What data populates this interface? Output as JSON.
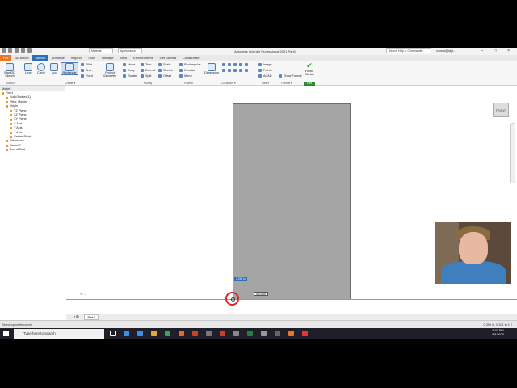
{
  "window": {
    "title": "Autodesk Inventor Professional 2021   Part1",
    "material": "Material",
    "appearance": "Appearance",
    "search_placeholder": "Search Help & Commands...",
    "user": "rcfusca@digit...",
    "controls": "– □ ×"
  },
  "ribbon_tabs": [
    "File",
    "3D Model",
    "Sketch",
    "Annotate",
    "Inspect",
    "Tools",
    "Manage",
    "View",
    "Environments",
    "Get Started",
    "Collaborate"
  ],
  "active_tab": "Sketch",
  "ribbon": {
    "start_sketch": "Start 2D Sketch",
    "line": "Line",
    "circle": "Circle",
    "arc": "Arc",
    "rectangle": "Rectangle",
    "fillet": "Fillet",
    "text": "Text",
    "point": "Point",
    "project_geometry": "Project Geometry",
    "move": "Move",
    "copy": "Copy",
    "rotate": "Rotate",
    "trim": "Trim",
    "extend": "Extend",
    "split": "Split",
    "scale": "Scale",
    "stretch": "Stretch",
    "offset": "Offset",
    "rect_pattern": "Rectangular",
    "circ_pattern": "Circular",
    "mirror": "Mirror",
    "dimension": "Dimension",
    "image": "Image",
    "points": "Points",
    "acad": "ACAD",
    "show_format": "Show Format",
    "finish_sketch": "Finish Sketch",
    "panels": {
      "sketch": "Sketch",
      "create": "Create ▾",
      "modify": "Modify",
      "pattern": "Pattern",
      "constrain": "Constrain ▾",
      "insert": "Insert",
      "format": "Format ▾",
      "exit": "Exit"
    }
  },
  "browser": {
    "header": "Model",
    "nodes": [
      {
        "label": "Part1",
        "indent": 0
      },
      {
        "label": "Solid Bodies(1)",
        "indent": 1
      },
      {
        "label": "View: Master",
        "indent": 1
      },
      {
        "label": "Origin",
        "indent": 1
      },
      {
        "label": "YZ Plane",
        "indent": 2
      },
      {
        "label": "XZ Plane",
        "indent": 2
      },
      {
        "label": "XY Plane",
        "indent": 2
      },
      {
        "label": "X Axis",
        "indent": 2
      },
      {
        "label": "Y Axis",
        "indent": 2
      },
      {
        "label": "Z Axis",
        "indent": 2
      },
      {
        "label": "Center Point",
        "indent": 2
      },
      {
        "label": "Extrusion1",
        "indent": 1
      },
      {
        "label": "Sketch2",
        "indent": 1
      },
      {
        "label": "End of Part",
        "indent": 1
      }
    ]
  },
  "canvas": {
    "dim_input": "1.296 in",
    "dim_input2": "0.101 in",
    "viewcube": "FRONT"
  },
  "doc_tabs": [
    "Part1"
  ],
  "status": {
    "left": "Select opposite corner",
    "right": "0.396 in, 0.101 in    1    2"
  },
  "taskbar": {
    "search": "Type here to search",
    "time": "5:02 PM",
    "date": "8/4/2020"
  },
  "colors": {
    "accent": "#2f6fb6",
    "file_tab": "#e87722",
    "rectangle_fill": "#a5a5a5",
    "cursor_ring": "#e02424"
  }
}
